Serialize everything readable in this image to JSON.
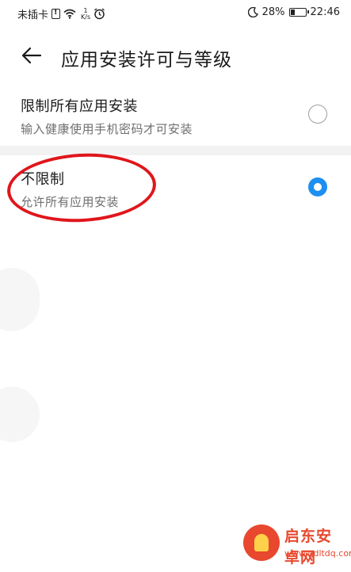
{
  "status_bar": {
    "carrier": "未插卡",
    "speed_value": "1",
    "speed_unit": "K/s",
    "battery": "28%",
    "battery_level": 0.28,
    "time": "22:46"
  },
  "header": {
    "title": "应用安装许可与等级"
  },
  "options": [
    {
      "title": "限制所有应用安装",
      "description": "输入健康使用手机密码才可安装",
      "selected": false
    },
    {
      "title": "不限制",
      "description": "允许所有应用安装",
      "selected": true
    }
  ],
  "colors": {
    "accent": "#1d8ff0",
    "annotation": "#e0161c",
    "watermark": "#e8482e"
  },
  "watermark": {
    "name": "启东安卓网",
    "url": "www.qdltdq.com"
  }
}
